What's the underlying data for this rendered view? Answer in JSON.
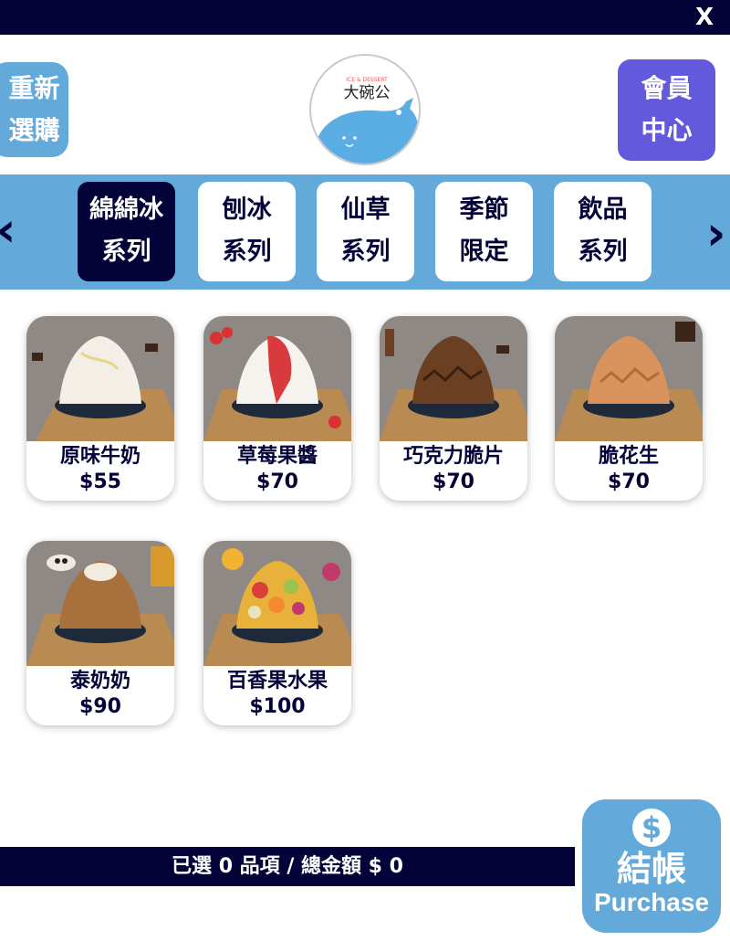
{
  "header": {
    "close_label": "X"
  },
  "reset_button": {
    "line1": "重新",
    "line2": "選購"
  },
  "member_button": {
    "line1": "會員",
    "line2": "中心"
  },
  "logo": {
    "text": "大碗公",
    "tagline": "ICE & DESSERT"
  },
  "categories": [
    {
      "line1": "綿綿冰",
      "line2": "系列",
      "active": true
    },
    {
      "line1": "刨冰",
      "line2": "系列",
      "active": false
    },
    {
      "line1": "仙草",
      "line2": "系列",
      "active": false
    },
    {
      "line1": "季節",
      "line2": "限定",
      "active": false
    },
    {
      "line1": "飲品",
      "line2": "系列",
      "active": false
    }
  ],
  "products": [
    {
      "name": "原味牛奶",
      "price": "$55",
      "topping": "milk"
    },
    {
      "name": "草莓果醬",
      "price": "$70",
      "topping": "strawberry"
    },
    {
      "name": "巧克力脆片",
      "price": "$70",
      "topping": "chocolate"
    },
    {
      "name": "脆花生",
      "price": "$70",
      "topping": "peanut"
    },
    {
      "name": "泰奶奶",
      "price": "$90",
      "topping": "thai-tea"
    },
    {
      "name": "百香果水果",
      "price": "$100",
      "topping": "fruit"
    }
  ],
  "summary": {
    "text": "已選 0 品項 / 總金額 $ 0"
  },
  "purchase_button": {
    "icon": "$",
    "label_zh": "結帳",
    "label_en": "Purchase"
  },
  "colors": {
    "navy": "#03033a",
    "sky": "#63a9d9",
    "purple": "#6259dc"
  }
}
